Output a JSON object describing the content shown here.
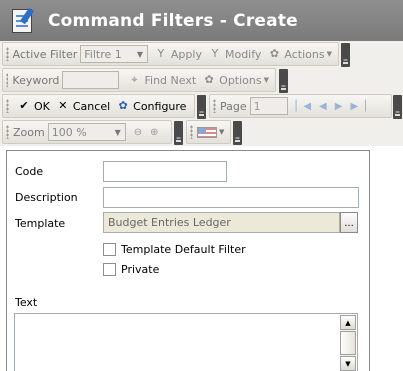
{
  "window": {
    "title": "Command Filters - Create"
  },
  "toolbar1": {
    "active_filter_label": "Active Filter",
    "active_filter_value": "Filtre 1",
    "apply": "Apply",
    "modify": "Modify",
    "actions": "Actions"
  },
  "toolbar2": {
    "keyword_label": "Keyword",
    "keyword_value": "",
    "find_next": "Find Next",
    "options": "Options"
  },
  "toolbar3": {
    "ok": "OK",
    "cancel": "Cancel",
    "configure": "Configure",
    "page_label": "Page",
    "page_value": "1"
  },
  "toolbar4": {
    "zoom_label": "Zoom",
    "zoom_value": "100 %"
  },
  "form": {
    "code_label": "Code",
    "code_value": "",
    "description_label": "Description",
    "description_value": "",
    "template_label": "Template",
    "template_value": "Budget Entries Ledger",
    "browse_label": "...",
    "template_default_filter_label": "Template Default Filter",
    "template_default_filter_checked": false,
    "private_label": "Private",
    "private_checked": false,
    "text_label": "Text",
    "text_value": ""
  },
  "colors": {
    "titlebar": "#858585",
    "toolbar": "#f0efeb",
    "accent_blue": "#2a5bb8"
  }
}
